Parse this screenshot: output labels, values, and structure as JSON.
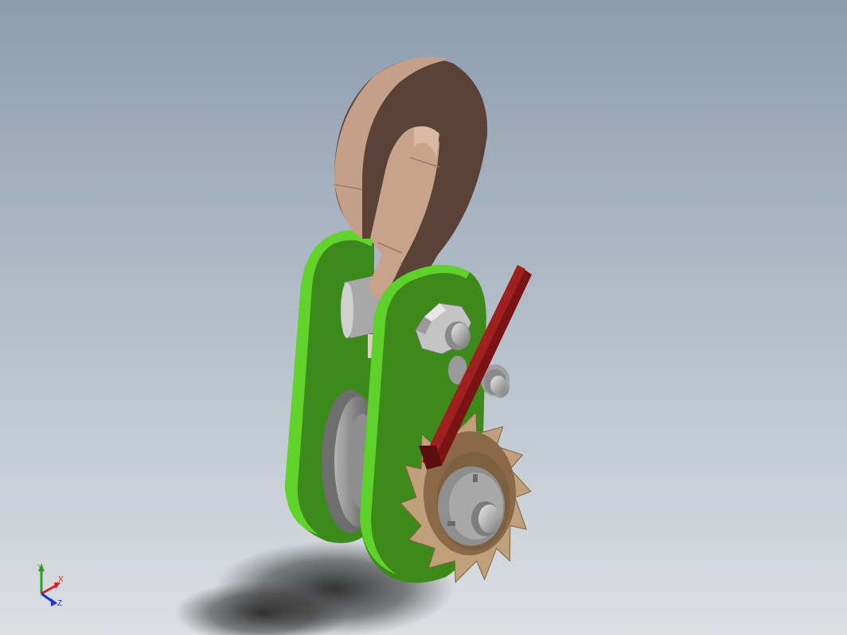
{
  "viewport": {
    "background_top": "#8c9db0",
    "background_bottom": "#dcdfe2"
  },
  "model": {
    "hook_color": "#c19a85",
    "hook_shade": "#5a4236",
    "side_plate_color": "#3d8a1a",
    "side_plate_edge": "#5dd12a",
    "pawl_color": "#6e1212",
    "ratchet_wheel_color": "#bfa07a",
    "pulley_color": "#8a8a8a",
    "nut_color": "#b8b8b8"
  },
  "triad": {
    "x_label": "X",
    "y_label": "Y",
    "z_label": "Z",
    "x_color": "#d42020",
    "y_color": "#2aa02a",
    "z_color": "#2030c8"
  }
}
